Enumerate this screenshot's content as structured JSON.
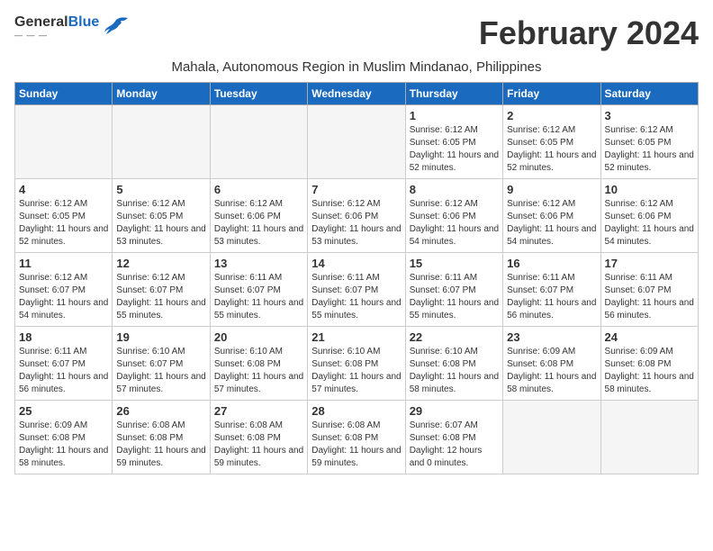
{
  "app": {
    "name_general": "General",
    "name_blue": "Blue"
  },
  "title": "February 2024",
  "subtitle": "Mahala, Autonomous Region in Muslim Mindanao, Philippines",
  "weekdays": [
    "Sunday",
    "Monday",
    "Tuesday",
    "Wednesday",
    "Thursday",
    "Friday",
    "Saturday"
  ],
  "weeks": [
    [
      {
        "day": "",
        "empty": true
      },
      {
        "day": "",
        "empty": true
      },
      {
        "day": "",
        "empty": true
      },
      {
        "day": "",
        "empty": true
      },
      {
        "day": "1",
        "sunrise": "6:12 AM",
        "sunset": "6:05 PM",
        "daylight": "11 hours and 52 minutes."
      },
      {
        "day": "2",
        "sunrise": "6:12 AM",
        "sunset": "6:05 PM",
        "daylight": "11 hours and 52 minutes."
      },
      {
        "day": "3",
        "sunrise": "6:12 AM",
        "sunset": "6:05 PM",
        "daylight": "11 hours and 52 minutes."
      }
    ],
    [
      {
        "day": "4",
        "sunrise": "6:12 AM",
        "sunset": "6:05 PM",
        "daylight": "11 hours and 52 minutes."
      },
      {
        "day": "5",
        "sunrise": "6:12 AM",
        "sunset": "6:05 PM",
        "daylight": "11 hours and 53 minutes."
      },
      {
        "day": "6",
        "sunrise": "6:12 AM",
        "sunset": "6:06 PM",
        "daylight": "11 hours and 53 minutes."
      },
      {
        "day": "7",
        "sunrise": "6:12 AM",
        "sunset": "6:06 PM",
        "daylight": "11 hours and 53 minutes."
      },
      {
        "day": "8",
        "sunrise": "6:12 AM",
        "sunset": "6:06 PM",
        "daylight": "11 hours and 54 minutes."
      },
      {
        "day": "9",
        "sunrise": "6:12 AM",
        "sunset": "6:06 PM",
        "daylight": "11 hours and 54 minutes."
      },
      {
        "day": "10",
        "sunrise": "6:12 AM",
        "sunset": "6:06 PM",
        "daylight": "11 hours and 54 minutes."
      }
    ],
    [
      {
        "day": "11",
        "sunrise": "6:12 AM",
        "sunset": "6:07 PM",
        "daylight": "11 hours and 54 minutes."
      },
      {
        "day": "12",
        "sunrise": "6:12 AM",
        "sunset": "6:07 PM",
        "daylight": "11 hours and 55 minutes."
      },
      {
        "day": "13",
        "sunrise": "6:11 AM",
        "sunset": "6:07 PM",
        "daylight": "11 hours and 55 minutes."
      },
      {
        "day": "14",
        "sunrise": "6:11 AM",
        "sunset": "6:07 PM",
        "daylight": "11 hours and 55 minutes."
      },
      {
        "day": "15",
        "sunrise": "6:11 AM",
        "sunset": "6:07 PM",
        "daylight": "11 hours and 55 minutes."
      },
      {
        "day": "16",
        "sunrise": "6:11 AM",
        "sunset": "6:07 PM",
        "daylight": "11 hours and 56 minutes."
      },
      {
        "day": "17",
        "sunrise": "6:11 AM",
        "sunset": "6:07 PM",
        "daylight": "11 hours and 56 minutes."
      }
    ],
    [
      {
        "day": "18",
        "sunrise": "6:11 AM",
        "sunset": "6:07 PM",
        "daylight": "11 hours and 56 minutes."
      },
      {
        "day": "19",
        "sunrise": "6:10 AM",
        "sunset": "6:07 PM",
        "daylight": "11 hours and 57 minutes."
      },
      {
        "day": "20",
        "sunrise": "6:10 AM",
        "sunset": "6:08 PM",
        "daylight": "11 hours and 57 minutes."
      },
      {
        "day": "21",
        "sunrise": "6:10 AM",
        "sunset": "6:08 PM",
        "daylight": "11 hours and 57 minutes."
      },
      {
        "day": "22",
        "sunrise": "6:10 AM",
        "sunset": "6:08 PM",
        "daylight": "11 hours and 58 minutes."
      },
      {
        "day": "23",
        "sunrise": "6:09 AM",
        "sunset": "6:08 PM",
        "daylight": "11 hours and 58 minutes."
      },
      {
        "day": "24",
        "sunrise": "6:09 AM",
        "sunset": "6:08 PM",
        "daylight": "11 hours and 58 minutes."
      }
    ],
    [
      {
        "day": "25",
        "sunrise": "6:09 AM",
        "sunset": "6:08 PM",
        "daylight": "11 hours and 58 minutes."
      },
      {
        "day": "26",
        "sunrise": "6:08 AM",
        "sunset": "6:08 PM",
        "daylight": "11 hours and 59 minutes."
      },
      {
        "day": "27",
        "sunrise": "6:08 AM",
        "sunset": "6:08 PM",
        "daylight": "11 hours and 59 minutes."
      },
      {
        "day": "28",
        "sunrise": "6:08 AM",
        "sunset": "6:08 PM",
        "daylight": "11 hours and 59 minutes."
      },
      {
        "day": "29",
        "sunrise": "6:07 AM",
        "sunset": "6:08 PM",
        "daylight": "12 hours and 0 minutes."
      },
      {
        "day": "",
        "empty": true
      },
      {
        "day": "",
        "empty": true
      }
    ]
  ]
}
